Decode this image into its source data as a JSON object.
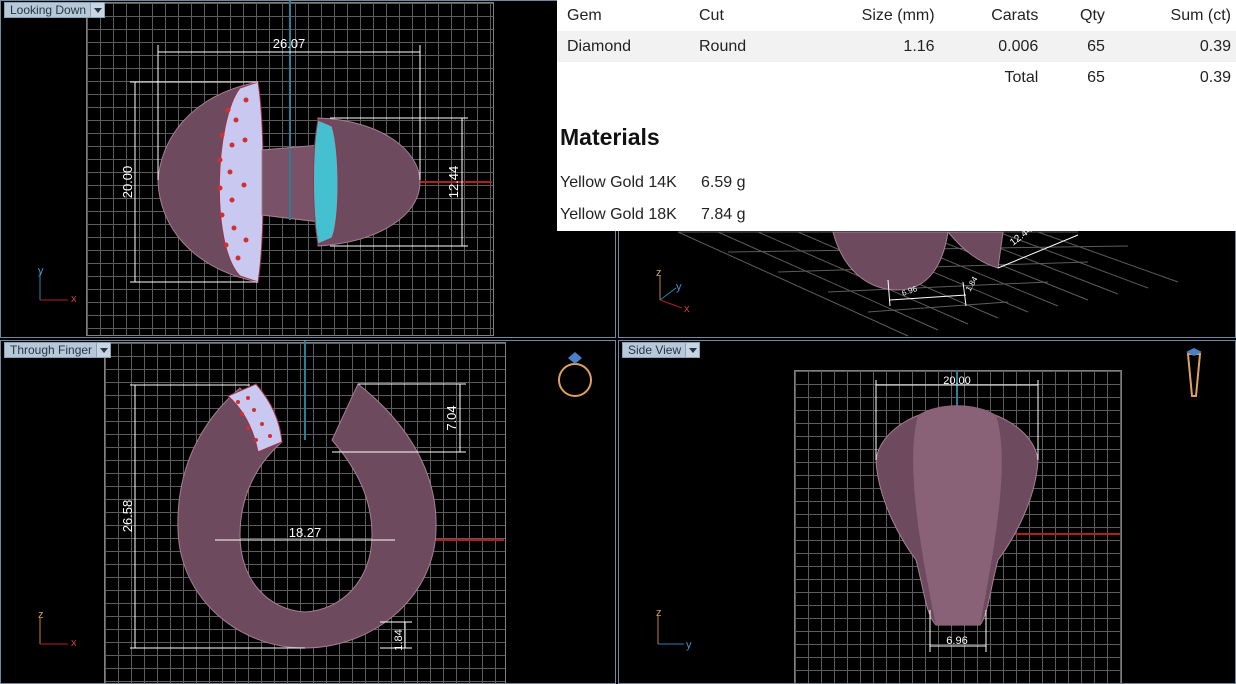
{
  "viewports": {
    "top_left": {
      "label": "Looking Down",
      "dims": [
        "26.07",
        "20.00",
        "12.44"
      ],
      "axes": [
        "y",
        "x"
      ]
    },
    "top_right": {
      "dims": [
        "12.44",
        "6.96",
        "1.84"
      ],
      "axes": [
        "z",
        "y",
        "x"
      ]
    },
    "bottom_left": {
      "label": "Through Finger",
      "dims": [
        "26.58",
        "18.27",
        "7.04",
        "1.84"
      ],
      "axes": [
        "z",
        "x"
      ]
    },
    "bottom_right": {
      "label": "Side View",
      "dims": [
        "20.00",
        "6.96"
      ],
      "axes": [
        "z",
        "y"
      ]
    }
  },
  "gems": {
    "headers": [
      "Gem",
      "Cut",
      "Size (mm)",
      "Carats",
      "Qty",
      "Sum (ct)"
    ],
    "rows": [
      {
        "gem": "Diamond",
        "cut": "Round",
        "size": "1.16",
        "carats": "0.006",
        "qty": "65",
        "sum": "0.39"
      }
    ],
    "total": {
      "label": "Total",
      "qty": "65",
      "sum": "0.39"
    }
  },
  "materials": {
    "title": "Materials",
    "items": [
      {
        "name": "Yellow Gold 14K",
        "weight": "6.59 g"
      },
      {
        "name": "Yellow Gold 18K",
        "weight": "7.84 g"
      }
    ]
  },
  "colors": {
    "ring": "#6e4a5e",
    "ring_light": "#a47f93",
    "pave": "#c8c8f0",
    "gem_red": "#d03030",
    "axis_blue": "#2a7f95",
    "axis_red": "#b02020"
  }
}
